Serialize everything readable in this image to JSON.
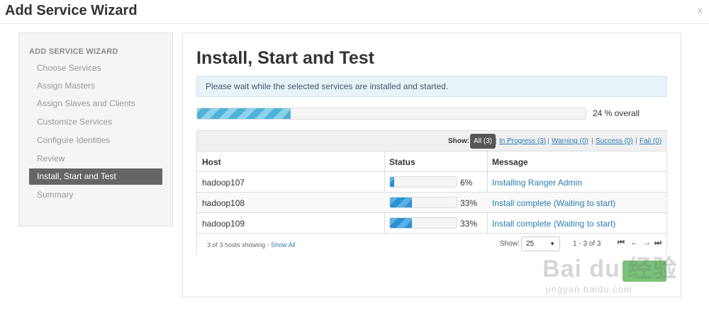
{
  "window": {
    "title": "Add Service Wizard",
    "close_label": "x"
  },
  "sidebar": {
    "heading": "ADD SERVICE WIZARD",
    "steps": [
      {
        "label": "Choose Services",
        "active": false
      },
      {
        "label": "Assign Masters",
        "active": false
      },
      {
        "label": "Assign Slaves and Clients",
        "active": false
      },
      {
        "label": "Customize Services",
        "active": false
      },
      {
        "label": "Configure Identities",
        "active": false
      },
      {
        "label": "Review",
        "active": false
      },
      {
        "label": "Install, Start and Test",
        "active": true
      },
      {
        "label": "Summary",
        "active": false
      }
    ]
  },
  "main": {
    "title": "Install, Start and Test",
    "alert": "Please wait while the selected services are installed and started.",
    "overall_progress": 24,
    "overall_text": "24 % overall"
  },
  "filters": {
    "show_label": "Show:",
    "all": "All (3)",
    "in_progress": "In Progress (3)",
    "warning": "Warning (0)",
    "success": "Success (0)",
    "fail": "Fail (0)",
    "separator": "|"
  },
  "table": {
    "columns": {
      "host": "Host",
      "status": "Status",
      "message": "Message"
    },
    "rows": [
      {
        "host": "hadoop107",
        "progress": 6,
        "percent": "6%",
        "message": "Installing Ranger Admin"
      },
      {
        "host": "hadoop108",
        "progress": 33,
        "percent": "33%",
        "message": "Install complete (Waiting to start)"
      },
      {
        "host": "hadoop109",
        "progress": 33,
        "percent": "33%",
        "message": "Install complete (Waiting to start)"
      }
    ]
  },
  "footer": {
    "showing": "3 of 3 hosts showing - ",
    "show_all": "Show All",
    "show_label": "Show:",
    "page_size": "25",
    "range": "1 - 3 of 3"
  },
  "icons": {
    "first": "⏮",
    "prev": "←",
    "next": "→",
    "last": "⏭"
  },
  "colors": {
    "accent": "#2a7db4",
    "progress_light": "#4bb3d9",
    "progress_dark": "#2b8fd2",
    "active_step": "#666666"
  },
  "watermark": {
    "text": "Bai du 经验",
    "sub": "jingyan.baidu.com"
  }
}
